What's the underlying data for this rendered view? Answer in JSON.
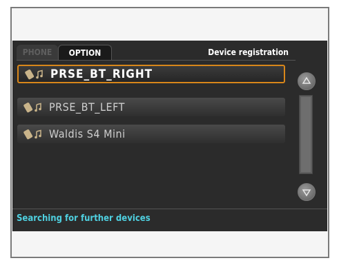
{
  "tabs": [
    {
      "label": "PHONE",
      "active": false
    },
    {
      "label": "OPTION",
      "active": true
    }
  ],
  "header": {
    "title": "Device registration"
  },
  "devices": [
    {
      "label": "PRSE_BT_RIGHT",
      "selected": true
    },
    {
      "label": "PRSE_BT_LEFT",
      "selected": false
    },
    {
      "label": "Waldis S4 Mini",
      "selected": false
    }
  ],
  "status": {
    "text": "Searching for further devices"
  },
  "colors": {
    "accent": "#d9871a",
    "status": "#4fd0e0",
    "screen": "#2b2b2b"
  },
  "icons": {
    "device": "phone-music-icon",
    "scroll_up": "triangle-up-icon",
    "scroll_down": "triangle-down-icon"
  }
}
